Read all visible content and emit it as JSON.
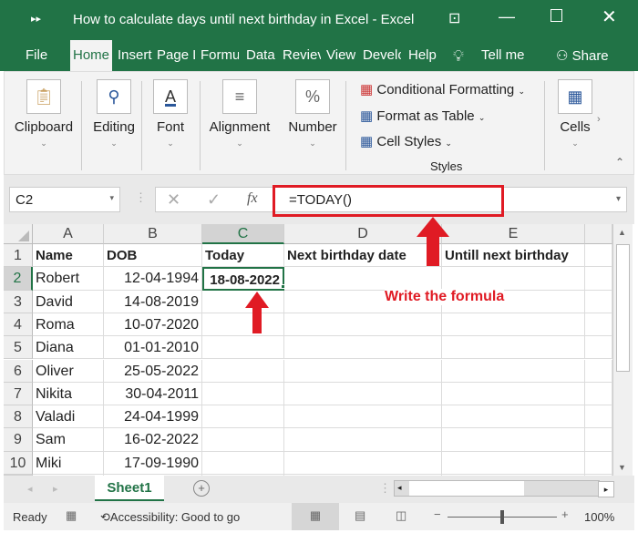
{
  "window": {
    "title": "How to calculate days until next birthday in Excel  -  Excel",
    "controls": [
      "ribbon-display",
      "minimize",
      "maximize",
      "close"
    ]
  },
  "tabs": [
    {
      "label": "File"
    },
    {
      "label": "Home",
      "active": true
    },
    {
      "label": "Insert"
    },
    {
      "label": "Page L"
    },
    {
      "label": "Formu"
    },
    {
      "label": "Data"
    },
    {
      "label": "Reviev"
    },
    {
      "label": "View"
    },
    {
      "label": "Develo"
    },
    {
      "label": "Help"
    }
  ],
  "tell_me": "Tell me",
  "share": "Share",
  "ribbon": {
    "groups": [
      {
        "label": "Clipboard",
        "icon": "clipboard-icon"
      },
      {
        "label": "Editing",
        "icon": "search-icon"
      },
      {
        "label": "Font",
        "icon": "font-icon"
      },
      {
        "label": "Alignment",
        "icon": "align-icon"
      },
      {
        "label": "Number",
        "icon": "percent-icon"
      },
      {
        "label": "Cells",
        "icon": "cells-icon"
      }
    ],
    "styles": {
      "items": [
        "Conditional Formatting",
        "Format as Table",
        "Cell Styles"
      ],
      "label": "Styles"
    }
  },
  "formula_bar": {
    "name_box": "C2",
    "fx": "fx",
    "formula": "=TODAY()"
  },
  "columns": [
    "A",
    "B",
    "C",
    "D",
    "E"
  ],
  "rows": [
    "1",
    "2",
    "3",
    "4",
    "5",
    "6",
    "7",
    "8",
    "9",
    "10"
  ],
  "headers": [
    "Name",
    "DOB",
    "Today",
    "Next birthday date",
    "Untill next birthday"
  ],
  "data": [
    [
      "Robert",
      "12-04-1994",
      "18-08-2022"
    ],
    [
      "David",
      "14-08-2019",
      ""
    ],
    [
      "Roma",
      "10-07-2020",
      ""
    ],
    [
      "Diana",
      "01-01-2010",
      ""
    ],
    [
      "Oliver",
      "25-05-2022",
      ""
    ],
    [
      "Nikita",
      "30-04-2011",
      ""
    ],
    [
      "Valadi",
      "24-04-1999",
      ""
    ],
    [
      "Sam",
      "16-02-2022",
      ""
    ],
    [
      "Miki",
      "17-09-1990",
      ""
    ]
  ],
  "annotation": {
    "text": "Write the formula",
    "color": "#e01b24"
  },
  "sheet_tab": "Sheet1",
  "status": {
    "ready": "Ready",
    "accessibility": "Accessibility: Good to go",
    "zoom": "100%"
  },
  "colors": {
    "brand": "#217346",
    "annotation": "#e01b24"
  }
}
